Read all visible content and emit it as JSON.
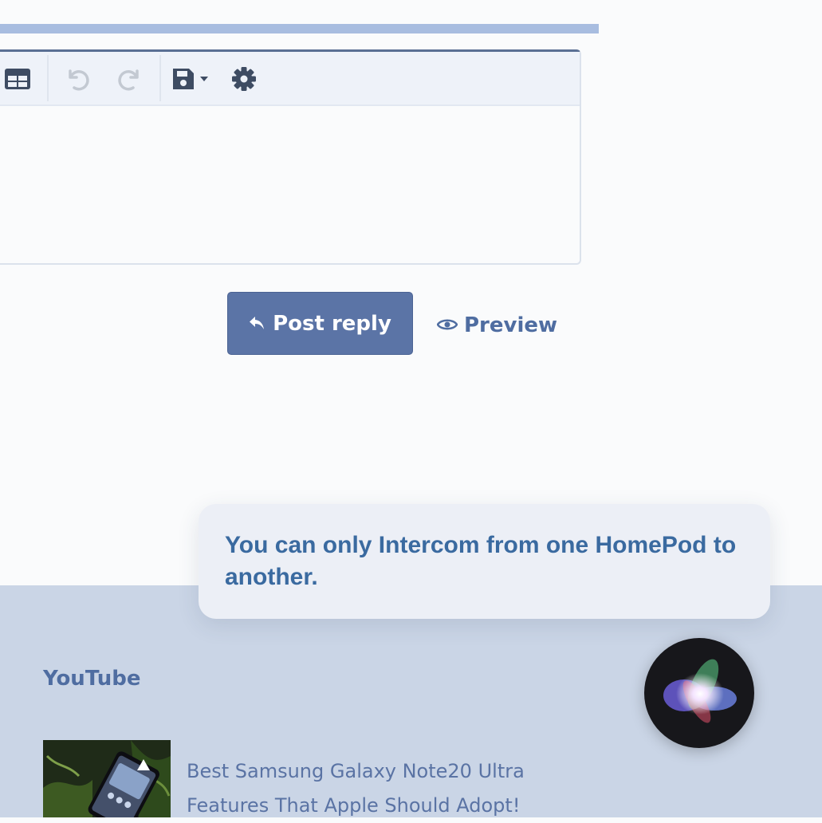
{
  "editor": {
    "toolbar": {
      "icons": [
        "table-icon",
        "undo-icon",
        "redo-icon",
        "save-draft-icon",
        "gear-icon"
      ]
    }
  },
  "actions": {
    "post_reply_label": "Post reply",
    "preview_label": "Preview"
  },
  "siri": {
    "message": "You can only Intercom from one HomePod to another."
  },
  "footer": {
    "youtube_heading": "YouTube",
    "video": {
      "title": "Best Samsung Galaxy Note20 Ultra Features That Apple Should Adopt!"
    }
  },
  "colors": {
    "accent": "#5b74a6",
    "link": "#4f6da1",
    "footer_bg": "#cad5e6",
    "siri_text": "#3a6aa0"
  }
}
